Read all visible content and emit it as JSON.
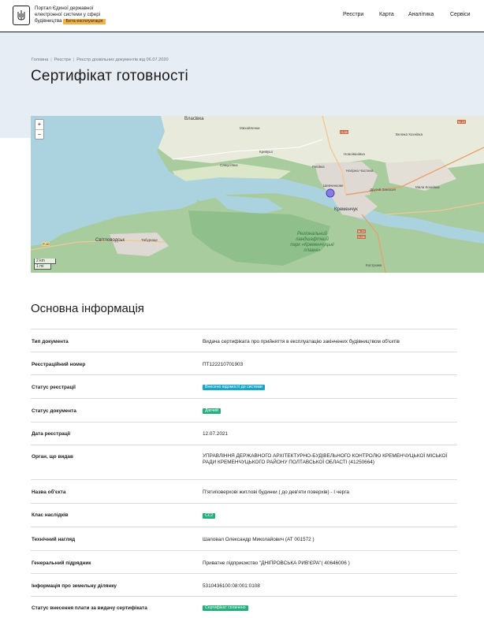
{
  "header": {
    "portal_line1": "Портал Єдиної державної",
    "portal_line2": "електронної системи у сфері",
    "portal_line3": "будівництва",
    "beta_badge": "Бeтa-експлуатація",
    "nav": [
      "Реєстри",
      "Карта",
      "Аналітика",
      "Сервіси"
    ]
  },
  "breadcrumb": [
    "Головна",
    "Реєстри",
    "Реєстр дозвільних документів від 06.07.2020"
  ],
  "page_title": "Сертифікат готовності",
  "map": {
    "zoom_in": "+",
    "zoom_out": "−",
    "scale_km": "2 km",
    "scale_mi": "1 mi",
    "labels": {
      "vlasivka": "Власівка",
      "mykhailenky": "Михайленки",
      "kryvushi": "Кривуші",
      "samusiivka": "Самусіївка",
      "revivka": "Ревівка",
      "shevchenkove": "Шевченкове",
      "kremenchuk": "Кременчук",
      "svitlovodsk": "Світловодськ",
      "tabury": "Табурище",
      "nahirna": "Нагірна Частина",
      "novoivanivka": "Новоіванівка",
      "velyka_kokhnivka": "Велика Кохнівка",
      "druhyi_zanasyp": "Другий Занасип",
      "mala_kokhnivka": "Мала Кохнівка",
      "kostroma": "Кострома",
      "park1": "Регіональний",
      "park2": "ландшафтний",
      "park3": "парк «Кременчуцькі",
      "park4": "плавні»",
      "h08_1": "Н-08",
      "m22_1": "М-22",
      "m22_2": "М-22",
      "h08_2": "Н-08",
      "p10": "Р-10"
    }
  },
  "info": {
    "section_title": "Основна інформація",
    "rows": [
      {
        "label": "Тип документа",
        "value": "Видача сертифіката про прийняття в експлуатацію закінчених будівництвом об'єктів"
      },
      {
        "label": "Реєстраційний номер",
        "value": "ПТ122210701903"
      },
      {
        "label": "Статус реєстрації",
        "badge": "Внесено відомості до системи"
      },
      {
        "label": "Статус документа",
        "badge": "Діючий"
      },
      {
        "label": "Дата реєстрації",
        "value": "12.07.2021"
      },
      {
        "label": "Орган, що видав",
        "value": "УПРАВЛІННЯ ДЕРЖАВНОГО АРХІТЕКТУРНО-БУДІВЕЛЬНОГО КОНТРОЛЮ КРЕМЕНЧУЦЬКОЇ МІСЬКОЇ РАДИ КРЕМЕНЧУЦЬКОГО РАЙОНУ ПОЛТАВСЬКОЇ ОБЛАСТІ (41250664)"
      },
      {
        "label": "Назва об'єкта",
        "value": "П'ятиповерхові житлові будинки ( до дев'яти поверхів) - I черга"
      },
      {
        "label": "Клас наслідків",
        "badge": "СС2"
      },
      {
        "label": "Технічний нагляд",
        "value": "Шаповал Олександр Миколайович (АТ 001572 )"
      },
      {
        "label": "Генеральний підрядник",
        "value": "Приватне підприємство \"ДНІПРОВСЬКА РИВ'ЄРА\"( 40646006 )"
      },
      {
        "label": "Інформація про земельну ділянку",
        "value": "5310436100:08:001:0108"
      },
      {
        "label": "Статус внесення плати за видачу сертифіката",
        "badge": "Сертифікат сплачено"
      }
    ]
  }
}
